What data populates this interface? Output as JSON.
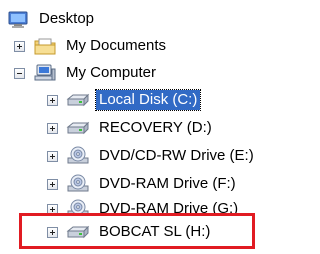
{
  "tree": {
    "root": {
      "label": "Desktop",
      "icon": "desktop-icon"
    },
    "my_documents": {
      "label": "My Documents",
      "icon": "folder-documents-icon",
      "state": "collapsed"
    },
    "my_computer": {
      "label": "My Computer",
      "icon": "computer-icon",
      "state": "expanded"
    },
    "drives": [
      {
        "label": "Local Disk (C:)",
        "icon": "hard-drive-icon",
        "selected": true
      },
      {
        "label": "RECOVERY (D:)",
        "icon": "hard-drive-icon"
      },
      {
        "label": "DVD/CD-RW Drive (E:)",
        "icon": "optical-drive-icon"
      },
      {
        "label": "DVD-RAM Drive (F:)",
        "icon": "optical-drive-icon"
      },
      {
        "label": "DVD-RAM Drive (G:)",
        "icon": "optical-drive-icon"
      },
      {
        "label": "BOBCAT SL (H:)",
        "icon": "hard-drive-icon"
      }
    ]
  },
  "colors": {
    "selection": "#316ac5",
    "highlight_box": "#e11b22"
  }
}
